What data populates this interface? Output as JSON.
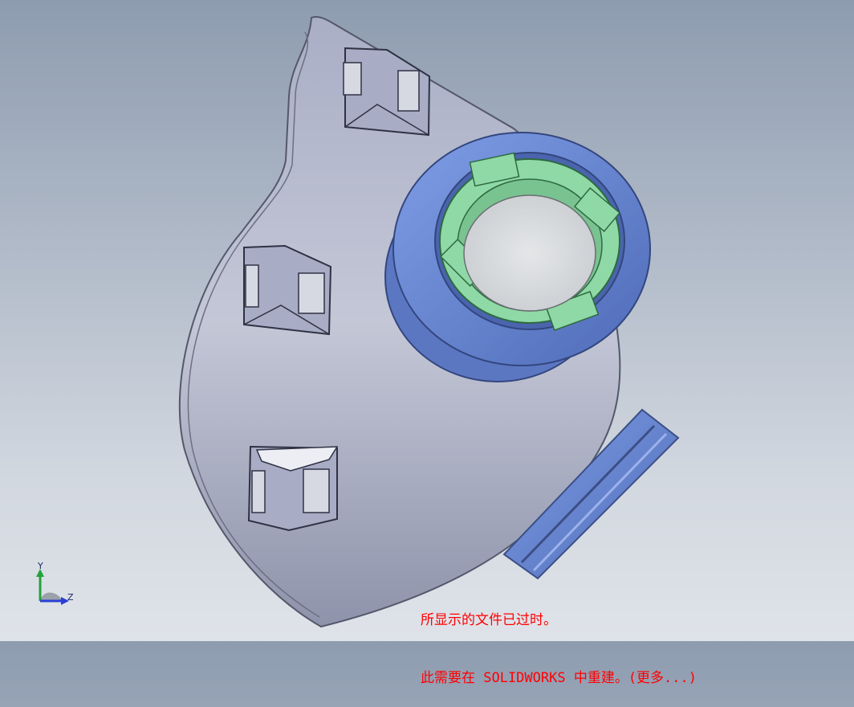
{
  "viewport": {
    "background_top": "#8e9cb0",
    "background_bottom": "#dfe3e9"
  },
  "model": {
    "body_color": "#b8bccd",
    "port_color": "#6f8fd6",
    "insert_color": "#8fd9a7",
    "lens_color": "#d9dcde"
  },
  "triad": {
    "y_label": "Y",
    "z_label": "Z",
    "y_color": "#22a33a",
    "z_color": "#2b3fd6"
  },
  "notice": {
    "line1": "所显示的文件已过时。",
    "line2": "此需要在 SOLIDWORKS 中重建。(更多...)",
    "color": "#ff0000"
  }
}
